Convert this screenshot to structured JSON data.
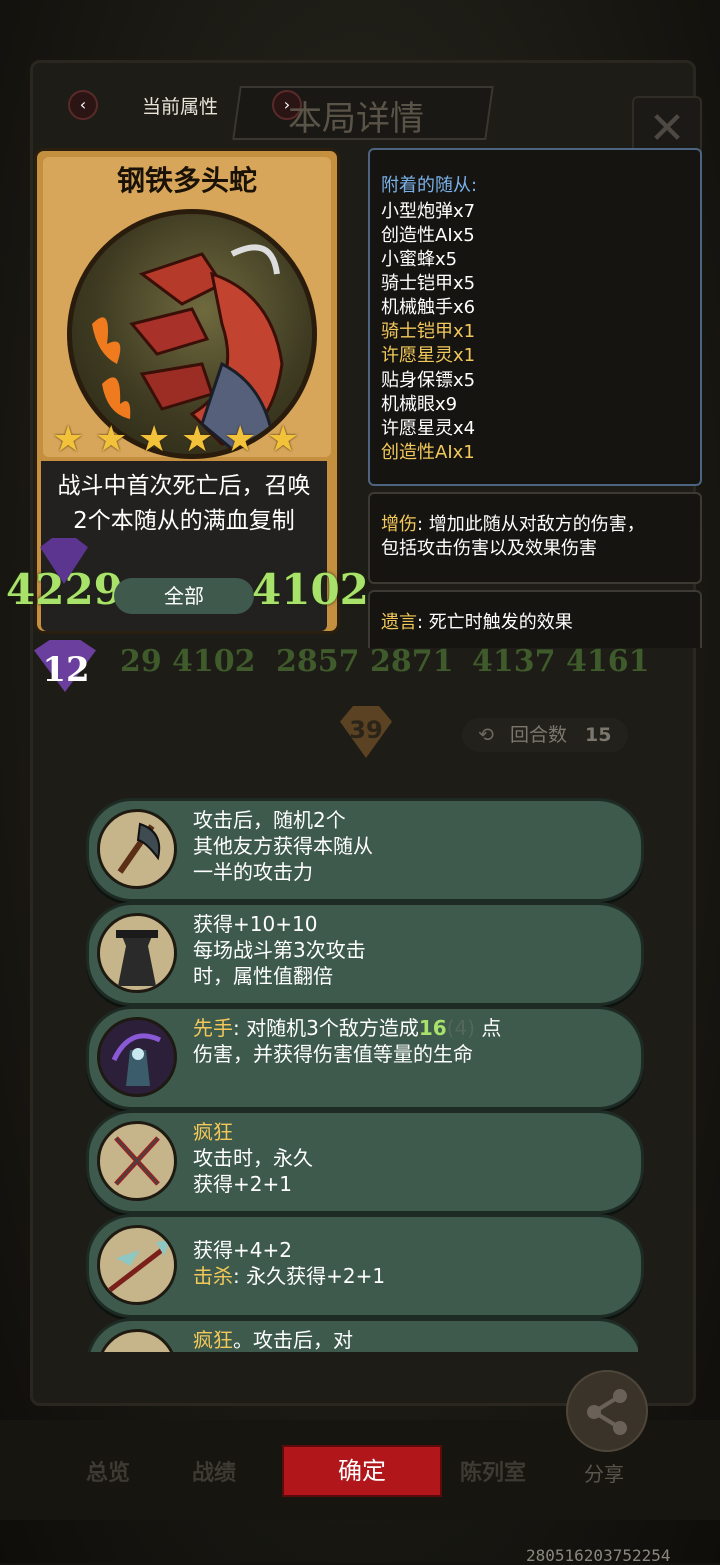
{
  "header": {
    "left_label": "当前属性",
    "title": "本局详情",
    "close_glyph": "✕"
  },
  "card": {
    "name": "钢铁多头蛇",
    "stars": 6,
    "description": "战斗中首次死亡后，召唤2个本随从的满血复制",
    "attack": "4229",
    "health": "4102",
    "filter_label": "全部",
    "tier": "12"
  },
  "minions": {
    "title": "附着的随从:",
    "items": [
      {
        "text": "小型炮弹x7",
        "highlight": false
      },
      {
        "text": "创造性AIx5",
        "highlight": false
      },
      {
        "text": "小蜜蜂x5",
        "highlight": false
      },
      {
        "text": "骑士铠甲x5",
        "highlight": false
      },
      {
        "text": "机械触手x6",
        "highlight": false
      },
      {
        "text": "骑士铠甲x1",
        "highlight": true
      },
      {
        "text": "许愿星灵x1",
        "highlight": true
      },
      {
        "text": "贴身保镖x5",
        "highlight": false
      },
      {
        "text": "机械眼x9",
        "highlight": false
      },
      {
        "text": "许愿星灵x4",
        "highlight": false
      },
      {
        "text": "创造性AIx1",
        "highlight": true
      }
    ]
  },
  "keywords": {
    "zengshang_kw": "增伤",
    "zengshang_text": ": 增加此随从对敌方的伤害，",
    "zengshang_text2": "包括攻击伤害以及效果伤害",
    "yiyan_kw": "遗言",
    "yiyan_text": ": 死亡时触发的效果"
  },
  "background": {
    "row_numbers": [
      "29",
      "4102",
      "2857",
      "2871",
      "4137",
      "4161"
    ],
    "chevron_value": "39",
    "round_label": "回合数",
    "round_value": "15"
  },
  "skills": [
    {
      "lines": [
        "攻击后，随机2个",
        "其他友方获得本随从",
        "一半的攻击力"
      ]
    },
    {
      "lines": [
        "获得+10+10",
        "每场战斗第3次攻击",
        "时，属性值翻倍"
      ]
    },
    {
      "kw": "先手",
      "line1_rest": ": 对随机3个敌方造成",
      "dmg": "16",
      "dmg_extra": "(4)",
      "line1_end": " 点",
      "line2": "伤害，并获得伤害值等量的生命"
    },
    {
      "kw": "疯狂",
      "lines": [
        "攻击时，永久",
        "获得+2+1"
      ]
    },
    {
      "line1": "获得+4+2",
      "kw": "击杀",
      "line2_rest": ": 永久获得+2+1"
    },
    {
      "kw": "疯狂",
      "rest": "。攻击后，对"
    }
  ],
  "bottom_nav": {
    "items": [
      "总览",
      "战绩",
      "陈列室"
    ],
    "confirm": "确定",
    "share": "分享"
  },
  "footer_id": "280516203752254"
}
